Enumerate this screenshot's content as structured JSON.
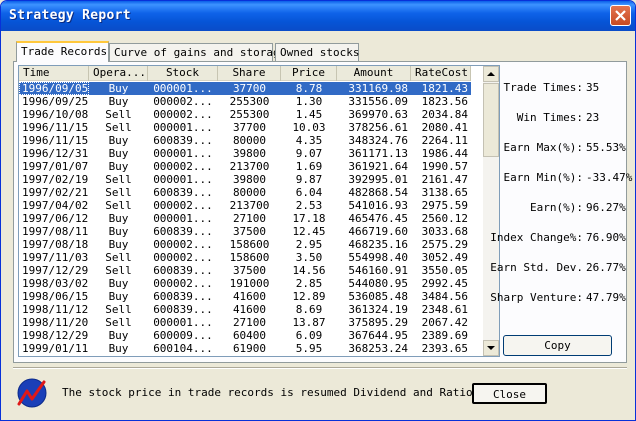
{
  "window": {
    "title": "Strategy Report"
  },
  "tabs": [
    {
      "label": "Trade Records"
    },
    {
      "label": "Curve of gains and storage"
    },
    {
      "label": "Owned stocks"
    }
  ],
  "table": {
    "columns": [
      "Time",
      "Opera...",
      "Stock",
      "Share",
      "Price",
      "Amount",
      "RateCost"
    ],
    "rows": [
      [
        "1996/09/05",
        "Buy",
        "000001...",
        "37700",
        "8.78",
        "331169.98",
        "1821.43"
      ],
      [
        "1996/09/25",
        "Buy",
        "000002...",
        "255300",
        "1.30",
        "331556.09",
        "1823.56"
      ],
      [
        "1996/10/08",
        "Sell",
        "000002...",
        "255300",
        "1.45",
        "369970.63",
        "2034.84"
      ],
      [
        "1996/11/15",
        "Sell",
        "000001...",
        "37700",
        "10.03",
        "378256.61",
        "2080.41"
      ],
      [
        "1996/11/15",
        "Buy",
        "600839...",
        "80000",
        "4.35",
        "348324.76",
        "2264.11"
      ],
      [
        "1996/12/31",
        "Buy",
        "000001...",
        "39800",
        "9.07",
        "361171.13",
        "1986.44"
      ],
      [
        "1997/01/07",
        "Buy",
        "000002...",
        "213700",
        "1.69",
        "361921.64",
        "1990.57"
      ],
      [
        "1997/02/19",
        "Sell",
        "000001...",
        "39800",
        "9.87",
        "392995.01",
        "2161.47"
      ],
      [
        "1997/02/21",
        "Sell",
        "600839...",
        "80000",
        "6.04",
        "482868.54",
        "3138.65"
      ],
      [
        "1997/04/02",
        "Sell",
        "000002...",
        "213700",
        "2.53",
        "541016.93",
        "2975.59"
      ],
      [
        "1997/06/12",
        "Buy",
        "000001...",
        "27100",
        "17.18",
        "465476.45",
        "2560.12"
      ],
      [
        "1997/08/11",
        "Buy",
        "600839...",
        "37500",
        "12.45",
        "466719.60",
        "3033.68"
      ],
      [
        "1997/08/18",
        "Buy",
        "000002...",
        "158600",
        "2.95",
        "468235.16",
        "2575.29"
      ],
      [
        "1997/11/03",
        "Sell",
        "000002...",
        "158600",
        "3.50",
        "554998.40",
        "3052.49"
      ],
      [
        "1997/12/29",
        "Sell",
        "600839...",
        "37500",
        "14.56",
        "546160.91",
        "3550.05"
      ],
      [
        "1998/03/02",
        "Buy",
        "000002...",
        "191000",
        "2.85",
        "544080.95",
        "2992.45"
      ],
      [
        "1998/06/15",
        "Buy",
        "600839...",
        "41600",
        "12.89",
        "536085.48",
        "3484.56"
      ],
      [
        "1998/11/12",
        "Sell",
        "600839...",
        "41600",
        "8.69",
        "361324.19",
        "2348.61"
      ],
      [
        "1998/11/20",
        "Sell",
        "000001...",
        "27100",
        "13.87",
        "375895.29",
        "2067.42"
      ],
      [
        "1998/12/29",
        "Buy",
        "600009...",
        "60400",
        "6.09",
        "367644.95",
        "2389.69"
      ],
      [
        "1999/01/11",
        "Buy",
        "600104...",
        "61900",
        "5.95",
        "368253.24",
        "2393.65"
      ]
    ],
    "selected_row": 0
  },
  "stats": [
    {
      "label": "Trade Times:",
      "value": "35"
    },
    {
      "label": "Win Times:",
      "value": "23"
    },
    {
      "label": "Earn Max(%):",
      "value": "55.53%"
    },
    {
      "label": "Earn Min(%):",
      "value": "-33.47%"
    },
    {
      "label": "Earn(%):",
      "value": "96.27%"
    },
    {
      "label": "Index Change%:",
      "value": "76.90%"
    },
    {
      "label": "Earn Std. Dev.",
      "value": "26.77%"
    },
    {
      "label": "Sharp Venture:",
      "value": "47.79%"
    }
  ],
  "buttons": {
    "copy": "Copy",
    "close": "Close"
  },
  "footer": {
    "note": "The stock price in trade records is resumed Dividend and Ration"
  },
  "colors": {
    "selection": "#316ac5",
    "titlebar": "#0a5fe8",
    "window_bg": "#ece9d8"
  },
  "icons": {
    "close": "close-x-icon",
    "logo": "trend-logo-icon",
    "scroll_up": "arrow-up-icon",
    "scroll_down": "arrow-down-icon"
  }
}
